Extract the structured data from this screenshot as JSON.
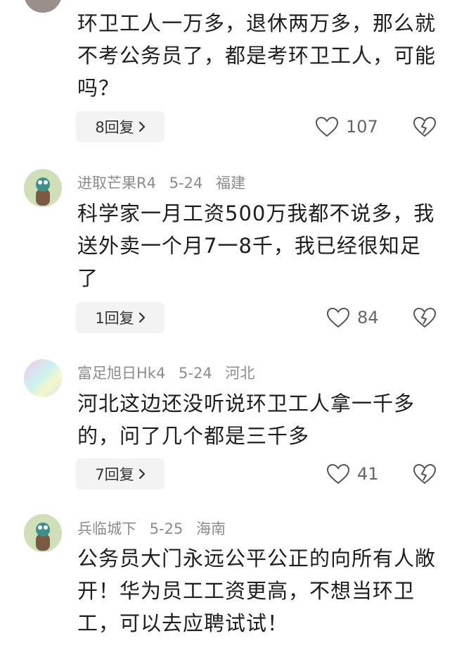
{
  "comments": [
    {
      "username": "",
      "date": "",
      "location": "",
      "text": "环卫工人一万多，退休两万多，那么就不考公务员了，都是考环卫工人，可能吗？",
      "reply_label": "8回复",
      "likes": "107",
      "avatar": "partial-top-avatar"
    },
    {
      "username": "进取芒果R4",
      "date": "5-24",
      "location": "福建",
      "text": "科学家一月工资500万我都不说多，我送外卖一个月7一8千，我已经很知足了",
      "reply_label": "1回复",
      "likes": "84",
      "avatar": "cartoon-avatar"
    },
    {
      "username": "富足旭日Hk4",
      "date": "5-24",
      "location": "河北",
      "text": "河北这边还没听说环卫工人拿一千多的，问了几个都是三千多",
      "reply_label": "7回复",
      "likes": "41",
      "avatar": "gradient-avatar"
    },
    {
      "username": "兵临城下",
      "date": "5-25",
      "location": "海南",
      "text": "公务员大门永远公平公正的向所有人敞开！华为员工工资更高，不想当环卫工，可以去应聘试试！",
      "reply_label": "",
      "likes": "",
      "avatar": "cartoon-avatar"
    }
  ],
  "icons": {
    "like": "heart-outline-icon",
    "dislike": "broken-heart-icon",
    "chevron": "chevron-right-icon"
  },
  "colors": {
    "meta_text": "#8c8c8c",
    "body_text": "#1e1e1e",
    "reply_bg": "#f3f3f3"
  }
}
